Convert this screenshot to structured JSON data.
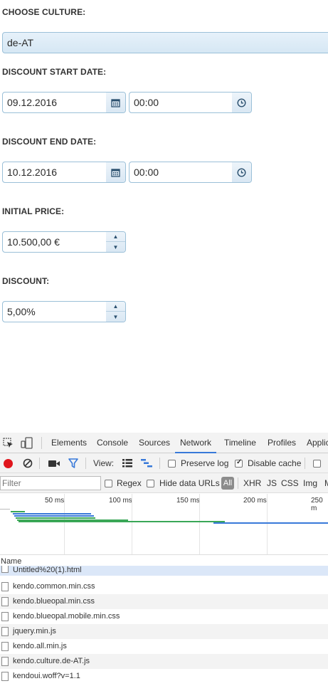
{
  "form": {
    "culture": {
      "label": "CHOOSE CULTURE:",
      "value": "de-AT"
    },
    "start": {
      "label": "DISCOUNT START DATE:",
      "date": "09.12.2016",
      "time": "00:00"
    },
    "end": {
      "label": "DISCOUNT END DATE:",
      "date": "10.12.2016",
      "time": "00:00"
    },
    "price": {
      "label": "INITIAL PRICE:",
      "value": "10.500,00 €"
    },
    "discount": {
      "label": "DISCOUNT:",
      "value": "5,00%"
    }
  },
  "devtools": {
    "tabs": [
      "Elements",
      "Console",
      "Sources",
      "Network",
      "Timeline",
      "Profiles",
      "Applic"
    ],
    "active_tab": "Network",
    "toolbar": {
      "view_label": "View:",
      "preserve_log": "Preserve log",
      "preserve_log_checked": false,
      "disable_cache": "Disable cache",
      "disable_cache_checked": true
    },
    "filter": {
      "placeholder": "Filter",
      "regex": "Regex",
      "hide_data_urls": "Hide data URLs",
      "types": [
        "All",
        "XHR",
        "JS",
        "CSS",
        "Img",
        "M"
      ]
    },
    "timeline_ticks": [
      "50 ms",
      "100 ms",
      "150 ms",
      "200 ms",
      "250 m"
    ],
    "list_header": "Name",
    "files": [
      "Untitled%20(1).html",
      "kendo.common.min.css",
      "kendo.blueopal.min.css",
      "kendo.blueopal.mobile.min.css",
      "jquery.min.js",
      "kendo.all.min.js",
      "kendo.culture.de-AT.js",
      "kendoui.woff?v=1.1"
    ]
  }
}
